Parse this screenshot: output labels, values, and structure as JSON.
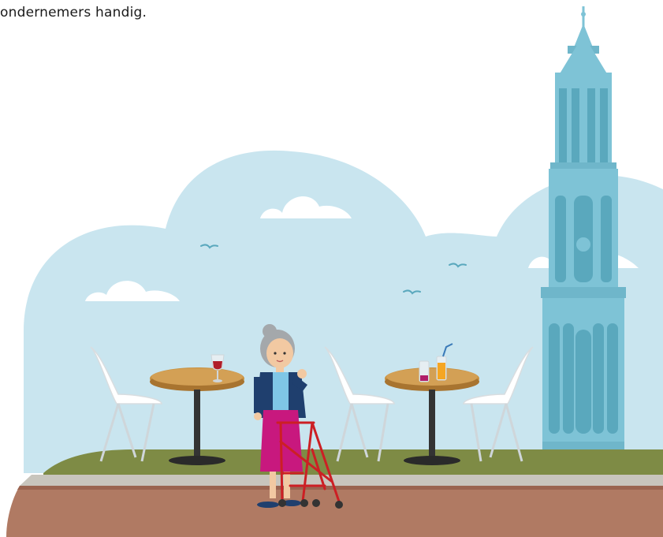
{
  "caption": "ondernemers handig.",
  "illustration": {
    "elements": [
      "sky-cloud-backdrop",
      "church-tower",
      "cafe-table-left",
      "cafe-table-right",
      "white-chair",
      "elderly-woman",
      "rollator-walker",
      "wine-glass",
      "juice-glass",
      "birds",
      "grass-strip",
      "sidewalk",
      "brick-ground"
    ]
  },
  "colors": {
    "sky": "#c9e5ef",
    "cloud": "#ffffff",
    "tower": "#7ec3d6",
    "tower_dark": "#5aa8bd",
    "grass": "#7e8b45",
    "sidewalk": "#c8c5bd",
    "ground": "#b07a63",
    "table_top": "#c8903f",
    "walker": "#cc1f24",
    "skirt": "#c8187e",
    "jacket": "#1f3f6e"
  }
}
